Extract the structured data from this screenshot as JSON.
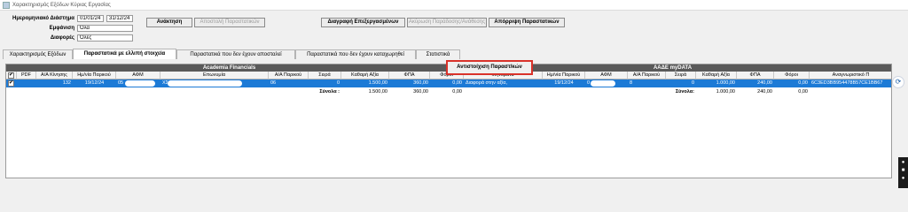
{
  "window": {
    "title": "Χαρακτηρισμός Εξόδων Κύριας Εργασίας"
  },
  "form": {
    "date_range_label": "Ημερομηνιακό Διάστημα",
    "date_from": "01/01/24",
    "date_to": "31/12/24",
    "display_label": "Εμφάνιση",
    "display_value": "Όλα",
    "diff_label": "Διαφορές",
    "diff_value": "Όλες"
  },
  "buttons": {
    "retrieve": "Ανάκτηση",
    "send_docs": "Αποστολή Παραστατικών",
    "delete_processed": "Διαγραφή Επεξεργασμένων",
    "cancel_char": "Ακύρωση Παράδοσης/Ανάθεσης",
    "reject_docs": "Απόρριψη Παραστατικών"
  },
  "tabs": [
    "Χαρακτηρισμός Εξόδων",
    "Παραστατικά με ελλιπή στοιχεία",
    "Παραστατικά που δεν έχουν αποσταλεί",
    "Παραστατικά που δεν έχουν καταχωρηθεί",
    "Στατιστικά"
  ],
  "grid": {
    "group_left": "Academia Financials",
    "group_right": "ΑΑΔΕ myDATA",
    "headers": {
      "pdf": "PDF",
      "aa": "Α/Α Κίνησης",
      "date": "Ημ/νία Παρικού",
      "afm": "ΑΦΜ",
      "name": "Επωνυμία",
      "aa_par": "Α/Α Παρικού",
      "series": "Σειρά",
      "net": "Καθαρή Αξία",
      "vat": "ΦΠΑ",
      "tax": "Φόροι",
      "msg": "Μηνύματα",
      "date2": "Ημ/νία Παρικού",
      "afm2": "ΑΦΜ",
      "aa_par2": "Α/Α Παρικού",
      "series2": "Σειρά",
      "net2": "Καθαρή Αξία",
      "vat2": "ΦΠΑ",
      "tax2": "Φόροι",
      "mark": "Αναγνωριστικό Π"
    },
    "row": {
      "aa": "132",
      "date": "19/12/24",
      "afm": "05",
      "name": "ΧΣ",
      "aa_par": "06",
      "series": "0",
      "net": "1.500,00",
      "vat": "360,00",
      "tax": "0,00",
      "msg": "Διαφορά στην αξία,",
      "date2": "19/12/24",
      "afm2": "0",
      "aa_par2": "8",
      "series2": "0",
      "net2": "1.000,00",
      "vat2": "240,00",
      "tax2": "0,00",
      "mark": "6C3ED3BB954478B57CE1BB67"
    },
    "totals": {
      "label": "Σύνολα :",
      "net": "1.500,00",
      "vat": "360,00",
      "tax": "0,00",
      "label2": "Σύνολα:",
      "net2": "1.000,00",
      "vat2": "240,00",
      "tax2": "0,00"
    }
  },
  "highlight": {
    "label": "Αντιστοίχιση Παραστ/κών"
  },
  "colors": {
    "selection": "#1c7ad6",
    "highlight_border": "#d9322a",
    "group_header": "#5a5a5a"
  }
}
